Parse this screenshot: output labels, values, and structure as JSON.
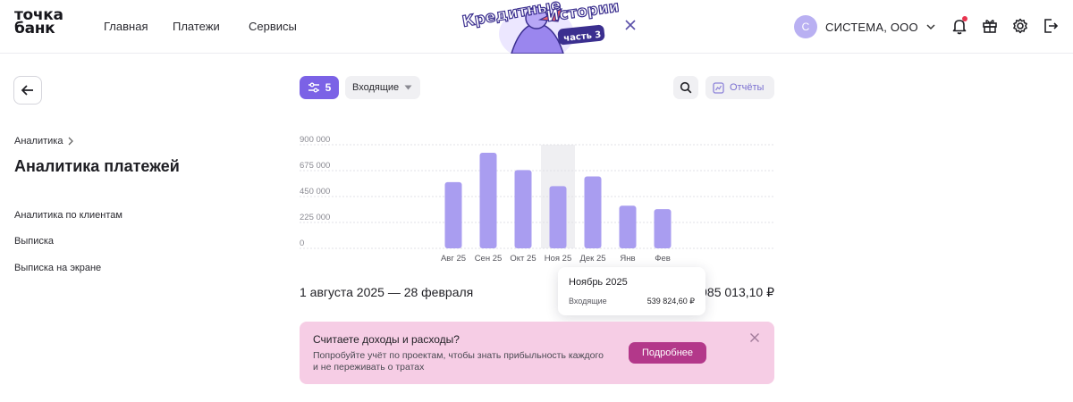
{
  "header": {
    "logo_line1": "точка",
    "logo_line2": "банк",
    "nav": [
      "Главная",
      "Платежи",
      "Сервисы"
    ],
    "promo": {
      "line1": "Кредитные",
      "line2": "Истории",
      "badge": "часть 3"
    },
    "account": {
      "avatar_letter": "С",
      "name": "СИСТЕМА, ООО"
    },
    "icons": [
      "bell-icon",
      "gift-icon",
      "gear-icon",
      "logout-icon"
    ]
  },
  "left": {
    "breadcrumb": "Аналитика",
    "title": "Аналитика платежей",
    "links": [
      "Аналитика по клиентам",
      "Выписка",
      "Выписка на экране"
    ]
  },
  "toolbar": {
    "filter_count": "5",
    "direction": "Входящие",
    "reports": "Отчёты"
  },
  "chart_data": {
    "type": "bar",
    "categories": [
      "Авг 25",
      "Сен 25",
      "Окт 25",
      "Ноя 25",
      "Дек 25",
      "Янв",
      "Фев"
    ],
    "values": [
      575000,
      830000,
      680000,
      539824.6,
      625000,
      370000,
      340000
    ],
    "y_ticks": [
      "0",
      "225 000",
      "450 000",
      "675 000",
      "900 000"
    ],
    "ylim": [
      0,
      900000
    ],
    "highlighted_index": 3,
    "bar_color": "#a99df0",
    "highlight_bg": "#efeff2",
    "grid": true
  },
  "summary": {
    "period": "1 августа 2025 — 28 февраля",
    "total": "985 013,10 ₽"
  },
  "tooltip": {
    "title": "Ноябрь 2025",
    "label": "Входящие",
    "value": "539 824,60 ₽"
  },
  "banner": {
    "title": "Считаете доходы и расходы?",
    "text": "Попробуйте учёт по проектам, чтобы знать прибыльность каждого и не переживать о тратах",
    "button": "Подробнее",
    "bg": "#f6cde5",
    "button_color": "#b3388a"
  }
}
